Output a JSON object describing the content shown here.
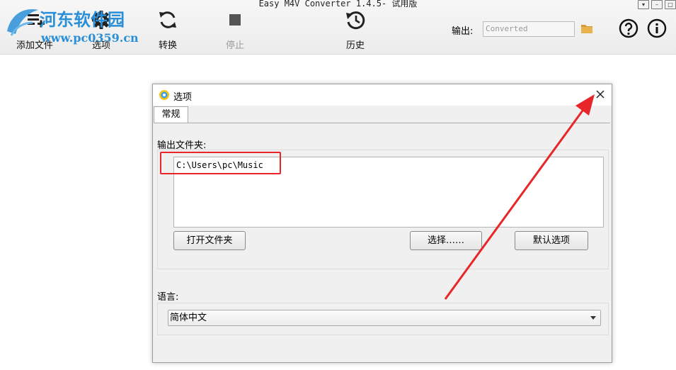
{
  "app": {
    "title": "Easy M4V Converter 1.4.5- 试用版",
    "window_controls": [
      "▾",
      "–",
      "□"
    ]
  },
  "toolbar": {
    "add_file_label": "添加文件",
    "options_label": "选项",
    "convert_label": "转换",
    "stop_label": "停止",
    "history_label": "历史",
    "output_label": "输出:",
    "output_placeholder": "Converted"
  },
  "watermark": {
    "main": "河东软件园",
    "sub": "www.pc0359.cn"
  },
  "dialog": {
    "title": "选项",
    "tabs": [
      {
        "label": "常规",
        "active": true
      }
    ],
    "output_folder_label": "输出文件夹:",
    "output_path": "C:\\Users\\pc\\Music",
    "open_folder_button": "打开文件夹",
    "choose_button": "选择……",
    "default_options_button": "默认选项",
    "language_label": "语言:",
    "language_value": "简体中文"
  },
  "colors": {
    "annotation_red": "#e8262a",
    "watermark_blue": "#2a8fd6"
  }
}
